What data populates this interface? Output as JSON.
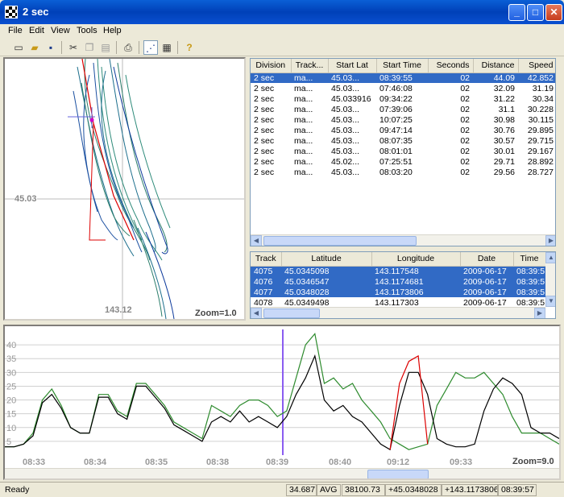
{
  "window": {
    "title": "2 sec"
  },
  "menu": [
    "File",
    "Edit",
    "View",
    "Tools",
    "Help"
  ],
  "toolbar": [
    "new-icon",
    "open-icon",
    "save-icon",
    "cut-icon",
    "copy-icon",
    "paste-icon",
    "print-icon",
    "map-view-icon",
    "table-view-icon",
    "help-icon"
  ],
  "map": {
    "lat_label": "45.03",
    "lon_label": "143.12",
    "zoom": "Zoom=1.0"
  },
  "divisions": {
    "columns": [
      "Division",
      "Track...",
      "Start Lat",
      "Start Time",
      "Seconds",
      "Distance",
      "Speed"
    ],
    "rows": [
      [
        "2 sec",
        "ma...",
        "45.03...",
        "08:39:55",
        "02",
        "44.09",
        "42.852"
      ],
      [
        "2 sec",
        "ma...",
        "45.03...",
        "07:46:08",
        "02",
        "32.09",
        "31.19"
      ],
      [
        "2 sec",
        "ma...",
        "45.033916",
        "09:34:22",
        "02",
        "31.22",
        "30.34"
      ],
      [
        "2 sec",
        "ma...",
        "45.03...",
        "07:39:06",
        "02",
        "31.1",
        "30.228"
      ],
      [
        "2 sec",
        "ma...",
        "45.03...",
        "10:07:25",
        "02",
        "30.98",
        "30.115"
      ],
      [
        "2 sec",
        "ma...",
        "45.03...",
        "09:47:14",
        "02",
        "30.76",
        "29.895"
      ],
      [
        "2 sec",
        "ma...",
        "45.03...",
        "08:07:35",
        "02",
        "30.57",
        "29.715"
      ],
      [
        "2 sec",
        "ma...",
        "45.03...",
        "08:01:01",
        "02",
        "30.01",
        "29.167"
      ],
      [
        "2 sec",
        "ma...",
        "45.02...",
        "07:25:51",
        "02",
        "29.71",
        "28.892"
      ],
      [
        "2 sec",
        "ma...",
        "45.03...",
        "08:03:20",
        "02",
        "29.56",
        "28.727"
      ]
    ]
  },
  "points": {
    "columns": [
      "Track",
      "Latitude",
      "Longitude",
      "Date",
      "Time"
    ],
    "rows": [
      [
        "4075",
        "45.0345098",
        "143.117548",
        "2009-06-17",
        "08:39:5"
      ],
      [
        "4076",
        "45.0346547",
        "143.1174681",
        "2009-06-17",
        "08:39:5"
      ],
      [
        "4077",
        "45.0348028",
        "143.1173806",
        "2009-06-17",
        "08:39:5"
      ],
      [
        "4078",
        "45.0349498",
        "143.117303",
        "2009-06-17",
        "08:39:5"
      ]
    ]
  },
  "chart_data": {
    "type": "line",
    "y_ticks": [
      "40",
      "35",
      "30",
      "25",
      "20",
      "15",
      "10",
      "5"
    ],
    "ylim": [
      0,
      45
    ],
    "x_ticks": [
      "08:33",
      "08:34",
      "08:35",
      "08:38",
      "08:39",
      "08:40",
      "09:12",
      "09:33"
    ],
    "zoom": "Zoom=9.0",
    "series": [
      {
        "color": "#2e8b2e",
        "values": [
          3,
          3,
          4,
          8,
          20,
          24,
          18,
          10,
          8,
          8,
          22,
          22,
          16,
          14,
          26,
          26,
          22,
          18,
          12,
          10,
          8,
          6,
          18,
          16,
          14,
          18,
          20,
          20,
          18,
          14,
          16,
          28,
          40,
          44,
          26,
          28,
          24,
          26,
          20,
          16,
          12,
          6,
          4,
          2,
          3,
          4,
          18,
          24,
          30,
          28,
          28,
          30,
          26,
          22,
          14,
          8,
          8,
          8,
          6,
          4
        ]
      },
      {
        "color": "#000000",
        "values": [
          3,
          3,
          4,
          7,
          19,
          22,
          17,
          10,
          8,
          8,
          21,
          21,
          15,
          13,
          25,
          25,
          21,
          17,
          11,
          9,
          7,
          5,
          12,
          14,
          12,
          16,
          12,
          14,
          12,
          10,
          14,
          22,
          28,
          36,
          20,
          16,
          18,
          14,
          12,
          8,
          4,
          2,
          18,
          30,
          30,
          22,
          6,
          4,
          3,
          3,
          4,
          16,
          24,
          28,
          26,
          22,
          10,
          8,
          8,
          6
        ]
      },
      {
        "color": "#dd0000",
        "values": [
          null,
          null,
          null,
          null,
          null,
          null,
          null,
          null,
          null,
          null,
          null,
          null,
          null,
          null,
          null,
          null,
          null,
          null,
          null,
          null,
          null,
          null,
          null,
          null,
          null,
          null,
          null,
          null,
          null,
          null,
          null,
          null,
          null,
          null,
          null,
          null,
          null,
          null,
          null,
          null,
          null,
          2,
          26,
          34,
          36,
          4,
          null,
          null,
          null,
          null,
          null,
          null,
          null,
          null,
          null,
          null,
          null,
          null,
          null,
          null
        ]
      }
    ]
  },
  "status": {
    "text": "Ready",
    "avg_value": "34.687",
    "avg_label": "AVG",
    "total": "38100.73",
    "lat": "+45.0348028",
    "lon": "+143.1173806",
    "time": "08:39:57"
  }
}
